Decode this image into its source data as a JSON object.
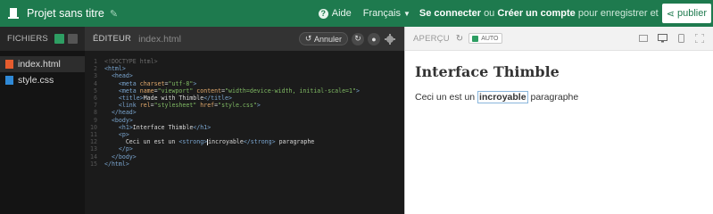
{
  "topbar": {
    "logo_icon": "thimble-logo-icon",
    "project_title": "Projet sans titre",
    "edit_icon": "pencil-icon",
    "help_label": "Aide",
    "language_label": "Français",
    "signin_label": "Se connecter",
    "or_label": "ou",
    "create_account_label": "Créer un compte",
    "account_suffix": "pour enregistrer et",
    "publish_label": "publier"
  },
  "sidebar": {
    "title": "FICHIERS",
    "files": [
      {
        "name": "index.html",
        "type": "html",
        "active": true
      },
      {
        "name": "style.css",
        "type": "css",
        "active": false
      }
    ]
  },
  "editor": {
    "label": "ÉDITEUR",
    "filename": "index.html",
    "undo_label": "Annuler",
    "lines": [
      "<!DOCTYPE html>",
      "<html>",
      "  <head>",
      "    <meta charset=\"utf-8\">",
      "    <meta name=\"viewport\" content=\"width=device-width, initial-scale=1\">",
      "    <title>Made with Thimble</title>",
      "    <link rel=\"stylesheet\" href=\"style.css\">",
      "  </head>",
      "  <body>",
      "    <h1>Interface Thimble</h1>",
      "    <p>",
      "      Ceci un est un <strong>incroyable</strong> paragraphe",
      "    </p>",
      "  </body>",
      "</html>"
    ]
  },
  "preview": {
    "label": "APERÇU",
    "auto_label": "AUTO",
    "heading": "Interface Thimble",
    "paragraph_before": "Ceci un est un",
    "paragraph_strong": "incroyable",
    "paragraph_after": "paragraphe"
  }
}
